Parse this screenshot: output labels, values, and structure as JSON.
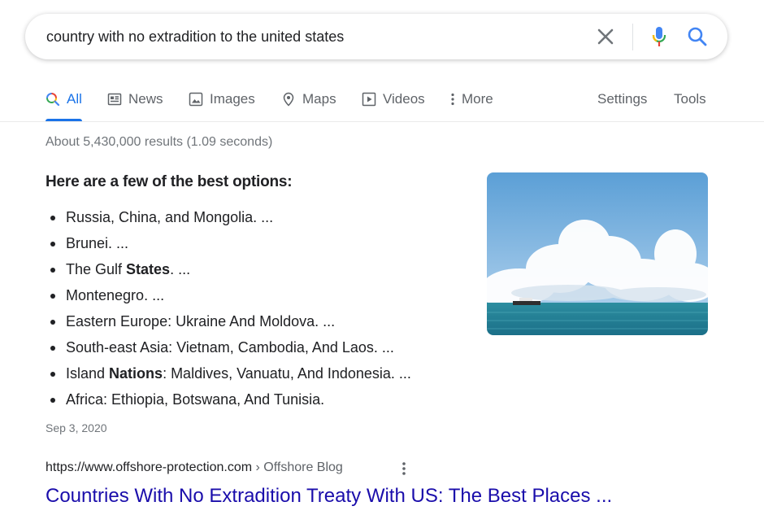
{
  "search": {
    "query": "country with no extradition to the united states"
  },
  "tabs": [
    {
      "label": "All",
      "icon": "search-multicolor-icon",
      "active": true
    },
    {
      "label": "News",
      "icon": "newspaper-icon"
    },
    {
      "label": "Images",
      "icon": "image-icon"
    },
    {
      "label": "Maps",
      "icon": "map-pin-icon"
    },
    {
      "label": "Videos",
      "icon": "play-icon"
    },
    {
      "label": "More",
      "icon": "vertical-dots-icon"
    },
    {
      "label": "Settings"
    },
    {
      "label": "Tools"
    }
  ],
  "result_stats": "About 5,430,000 results (1.09 seconds)",
  "featured_snippet": {
    "heading": "Here are a few of the best options:",
    "items": [
      {
        "pre": "Russia, China, and Mongolia. ...",
        "bold": "",
        "post": ""
      },
      {
        "pre": "Brunei. ...",
        "bold": "",
        "post": ""
      },
      {
        "pre": "The Gulf ",
        "bold": "States",
        "post": ". ..."
      },
      {
        "pre": "Montenegro. ...",
        "bold": "",
        "post": ""
      },
      {
        "pre": "Eastern Europe: Ukraine And Moldova. ...",
        "bold": "",
        "post": ""
      },
      {
        "pre": "South-east Asia: Vietnam, Cambodia, And Laos. ...",
        "bold": "",
        "post": ""
      },
      {
        "pre": "Island ",
        "bold": "Nations",
        "post": ": Maldives, Vanuatu, And Indonesia. ..."
      },
      {
        "pre": "Africa: Ethiopia, Botswana, And Tunisia.",
        "bold": "",
        "post": ""
      }
    ],
    "date": "Sep 3, 2020",
    "image": "ocean-clouds-boat-thumbnail"
  },
  "result": {
    "url": "https://www.offshore-protection.com",
    "breadcrumb": " › Offshore Blog",
    "title": "Countries With No Extradition Treaty With US: The Best Places ..."
  },
  "colors": {
    "link": "#1a0dab",
    "accent": "#1a73e8",
    "muted": "#70757a"
  }
}
